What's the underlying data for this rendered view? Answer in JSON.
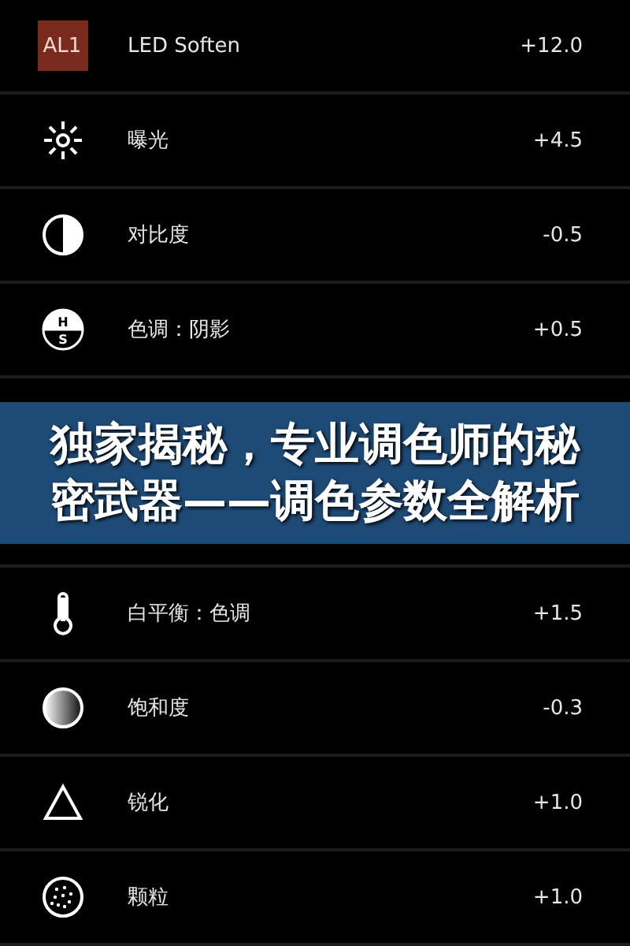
{
  "rows_top": [
    {
      "kind": "badge",
      "badge": "AL1",
      "label": "LED Soften",
      "value": "+12.0"
    },
    {
      "kind": "sun",
      "label": "曝光",
      "value": "+4.5"
    },
    {
      "kind": "contrast",
      "label": "对比度",
      "value": "-0.5"
    },
    {
      "kind": "hs",
      "icon_letters": [
        "H",
        "S"
      ],
      "label": "色调：阴影",
      "value": "+0.5"
    }
  ],
  "banner": {
    "title": "独家揭秘，专业调色师的秘密武器——调色参数全解析"
  },
  "rows_bottom": [
    {
      "kind": "thermometer",
      "label": "白平衡：色调",
      "value": "+1.5"
    },
    {
      "kind": "saturation",
      "label": "饱和度",
      "value": "-0.3"
    },
    {
      "kind": "triangle",
      "label": "锐化",
      "value": "+1.0"
    },
    {
      "kind": "grain",
      "label": "颗粒",
      "value": "+1.0"
    }
  ]
}
